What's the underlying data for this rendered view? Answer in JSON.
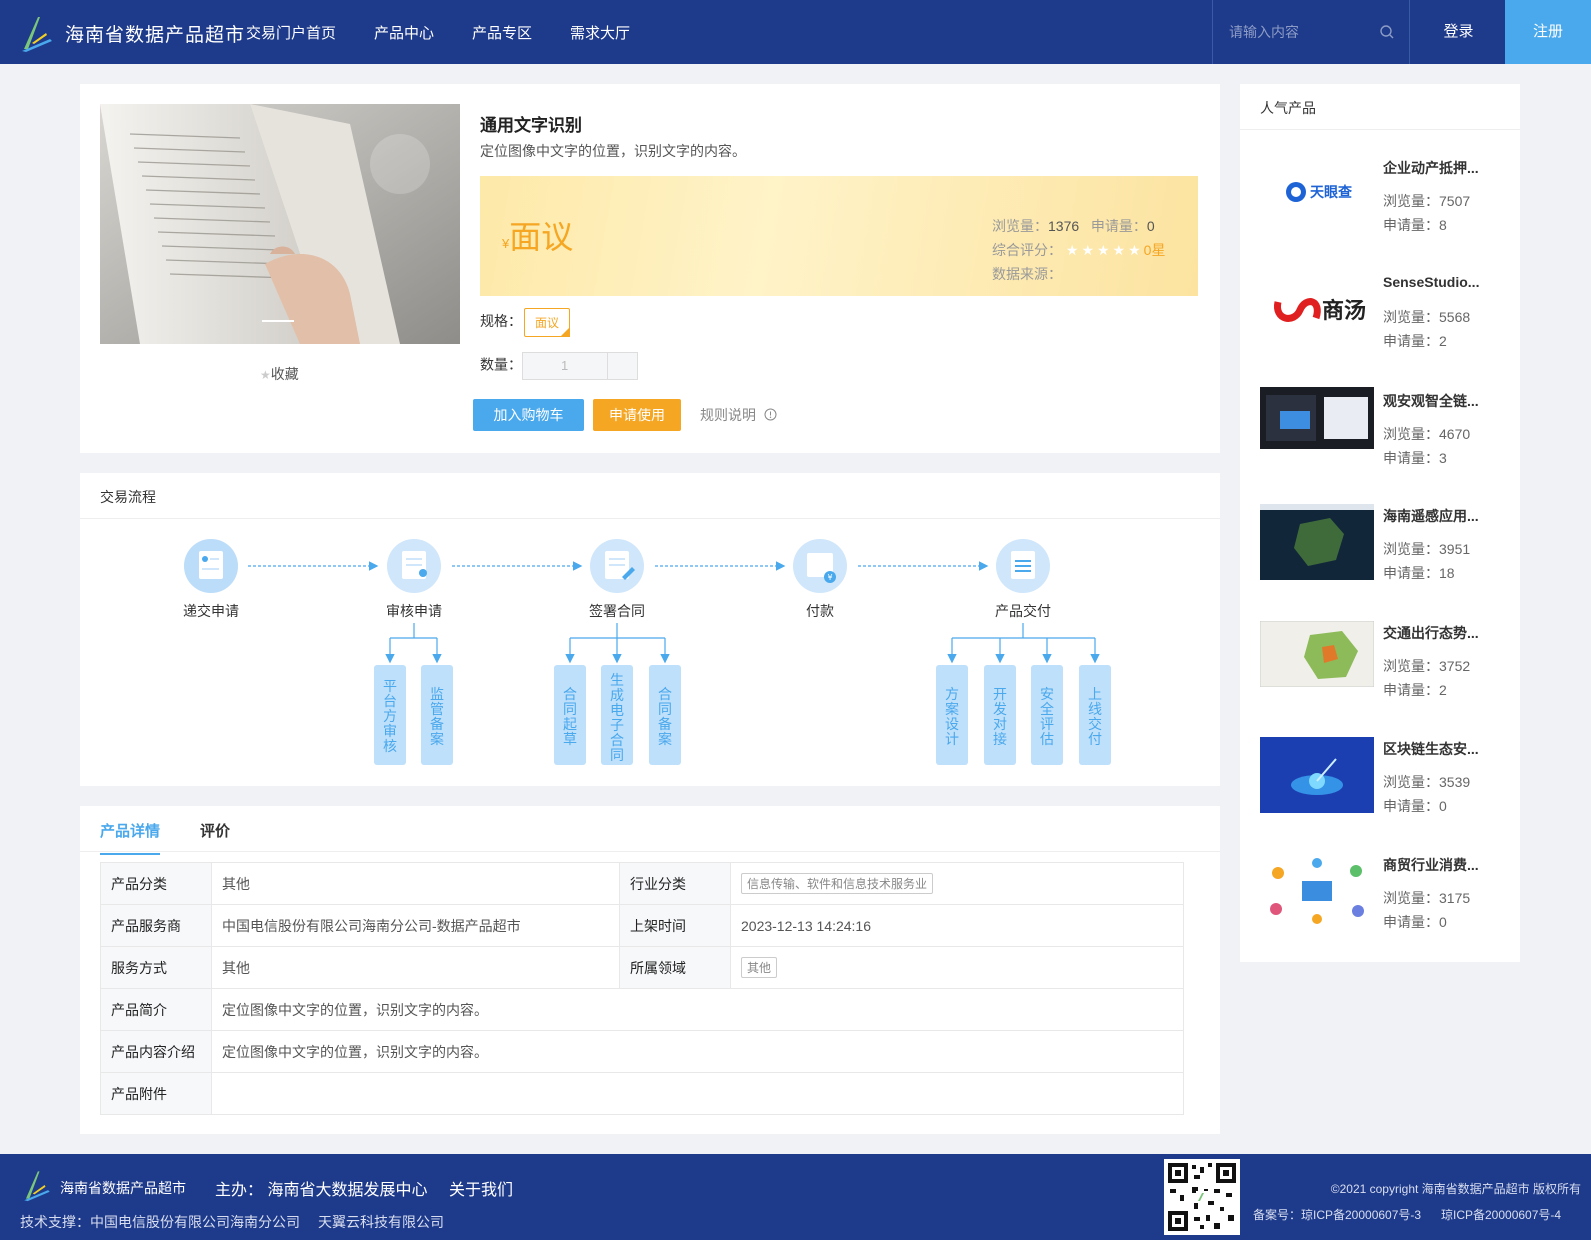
{
  "header": {
    "brand": "海南省数据产品超市",
    "nav": [
      "交易门户首页",
      "产品中心",
      "产品专区",
      "需求大厅"
    ],
    "search_placeholder": "请输入内容",
    "login": "登录",
    "register": "注册"
  },
  "product": {
    "title": "通用文字识别",
    "desc": "定位图像中文字的位置，识别文字的内容。",
    "currency": "¥",
    "price": "面议",
    "views_label": "浏览量：",
    "views": "1376",
    "apply_label": "申请量：",
    "apply": "0",
    "rating_label": "综合评分：",
    "rating_stars": "★★★★★",
    "rating_text": "0星",
    "source_label": "数据来源：",
    "spec_label": "规格：",
    "spec_value": "面议",
    "qty_label": "数量：",
    "qty_value": "1",
    "favorite": "收藏",
    "add_cart": "加入购物车",
    "apply_use": "申请使用",
    "rules": "规则说明"
  },
  "flow": {
    "title": "交易流程",
    "steps": [
      "递交申请",
      "审核申请",
      "签署合同",
      "付款",
      "产品交付"
    ],
    "audit_sub": [
      "平台方审核",
      "监管备案"
    ],
    "contract_sub": [
      "合同起草",
      "生成电子合同",
      "合同备案"
    ],
    "deliver_sub": [
      "方案设计",
      "开发对接",
      "安全评估",
      "上线交付"
    ]
  },
  "details": {
    "tabs": [
      "产品详情",
      "评价"
    ],
    "rows": {
      "category_label": "产品分类",
      "category": "其他",
      "industry_label": "行业分类",
      "industry": "信息传输、软件和信息技术服务业",
      "provider_label": "产品服务商",
      "provider": "中国电信股份有限公司海南分公司-数据产品超市",
      "online_label": "上架时间",
      "online": "2023-12-13 14:24:16",
      "service_label": "服务方式",
      "service": "其他",
      "domain_label": "所属领域",
      "domain": "其他",
      "intro_label": "产品简介",
      "intro": "定位图像中文字的位置，识别文字的内容。",
      "content_label": "产品内容介绍",
      "content": "定位图像中文字的位置，识别文字的内容。",
      "attach_label": "产品附件",
      "attach": ""
    }
  },
  "popular": {
    "title": "人气产品",
    "views_label": "浏览量：",
    "apply_label": "申请量：",
    "items": [
      {
        "name": "企业动产抵押...",
        "views": "7507",
        "apply": "8",
        "thumb_text": "天眼查"
      },
      {
        "name": "SenseStudio...",
        "views": "5568",
        "apply": "2",
        "thumb_text": "商汤"
      },
      {
        "name": "观安观智全链...",
        "views": "4670",
        "apply": "3"
      },
      {
        "name": "海南遥感应用...",
        "views": "3951",
        "apply": "18"
      },
      {
        "name": "交通出行态势...",
        "views": "3752",
        "apply": "2"
      },
      {
        "name": "区块链生态安...",
        "views": "3539",
        "apply": "0"
      },
      {
        "name": "商贸行业消费...",
        "views": "3175",
        "apply": "0"
      }
    ]
  },
  "footer": {
    "brand": "海南省数据产品超市",
    "host": "主办： 海南省大数据发展中心",
    "about": "关于我们",
    "support": "技术支撑：中国电信股份有限公司海南分公司",
    "support2": "天翼云科技有限公司",
    "copyright": "©2021 copyright 海南省数据产品超市 版权所有",
    "icp1": "备案号：琼ICP备20000607号-3",
    "icp2": "琼ICP备20000607号-4"
  },
  "colors": {
    "header_bg": "#1e3a8a",
    "accent_blue": "#4aa8ec",
    "accent_orange": "#f5a623"
  }
}
